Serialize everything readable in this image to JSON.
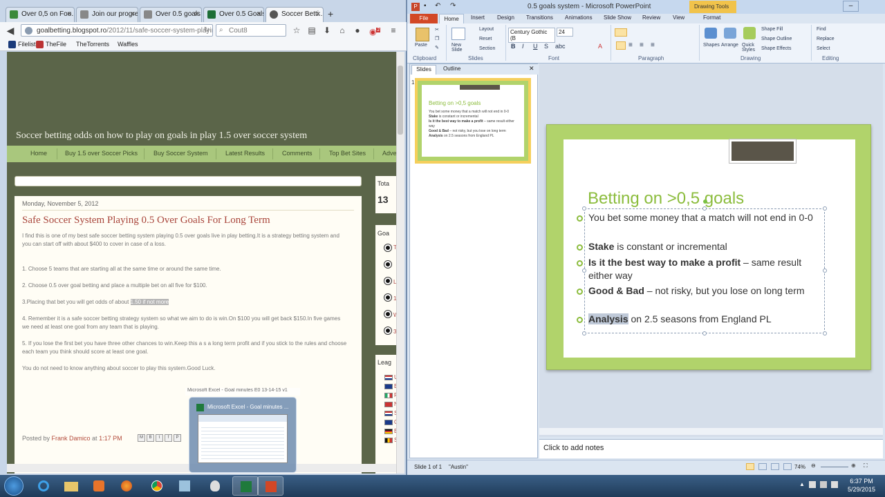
{
  "firefox": {
    "tabs": [
      {
        "label": "Over 0,5 on Foo...",
        "color": "#3b8a3b"
      },
      {
        "label": "Join our progres...",
        "color": "#888"
      },
      {
        "label": "Over 0.5 goals (...",
        "color": "#888"
      },
      {
        "label": "Over 0.5 Goals P...",
        "color": "#1d6e36"
      },
      {
        "label": "Soccer Betti...",
        "color": "#555"
      }
    ],
    "new_tab": "+",
    "url_prefix": "goalbetting.blogspot.ro",
    "url_rest": "/2012/11/safe-soccer-system-playing-05-c",
    "search_placeholder": "Cout8",
    "badge": "2",
    "bookmarks": [
      "Filelist",
      "TheFile",
      "TheTorrents",
      "Waffles"
    ],
    "blog": {
      "title": "Soccer betting odds on how to play on goals in play 1.5 over soccer system",
      "menu": [
        "Home",
        "Buy 1.5 over Soccer Picks",
        "Buy Soccer System",
        "Latest Results",
        "Comments",
        "Top Bet Sites",
        "Adve"
      ],
      "date": "Monday, November 5, 2012",
      "post_title": "Safe Soccer System Playing 0.5 Over Goals For Long Term",
      "intro": "I find this is one of my best safe soccer betting system playing 0.5 over goals live in play betting.It is a strategy betting system and you can start off with about $400 to cover in case of a loss.",
      "p1": "1. Choose 5 teams that are starting all at the same time or around the same time.",
      "p2": "2. Choose 0.5 over goal betting and place a multiple bet on all five for $100.",
      "p3_a": "3.Placing that bet you will get odds of about ",
      "p3_hl": "1.50 if not more",
      "p4": "4. Remember it is a safe soccer betting strategy system so what we aim to do is win.On $100 you will get back $150.In five games we need at least one goal from any team that is playing.",
      "p5": "5. If you lose the first bet you have three other chances to win.Keep this a s a long term profit and if you stick to the rules and choose each team you think should score at least one goal.",
      "p6": "You do not need to know anything about soccer to play this system.Good Luck.",
      "posted_by": "Posted by ",
      "author": "Frank Damico",
      "at": " at ",
      "time": "1:17 PM",
      "share": [
        "M",
        "B",
        "t",
        "f",
        "P"
      ],
      "sidebar_total": "Tota",
      "sidebar_total_num": "13",
      "sidebar_goals": "Goa",
      "sidebar_leagues": "Leag",
      "sidebar_ball_letters": [
        "T",
        "",
        "L",
        "1",
        "W",
        "3"
      ],
      "sidebar_flag_letters": [
        "U",
        "E",
        "F",
        "N",
        "S",
        "G",
        "E",
        "S"
      ]
    },
    "excel_preview": {
      "tooltip": "Microsoft Excel - Goal minutes E0 13-14-15 v1",
      "title": "Microsoft Excel - Goal minutes ..."
    }
  },
  "powerpoint": {
    "title": "0.5 goals system - Microsoft PowerPoint",
    "contextual": "Drawing Tools",
    "tabs": [
      "File",
      "Home",
      "Insert",
      "Design",
      "Transitions",
      "Animations",
      "Slide Show",
      "Review",
      "View",
      "Format"
    ],
    "ribbon": {
      "paste": "Paste",
      "new_slide": "New Slide",
      "layout": "Layout",
      "reset": "Reset",
      "section": "Section",
      "font_name": "Century Gothic (B",
      "font_size": "24",
      "shapes": "Shapes",
      "arrange": "Arrange",
      "quick_styles": "Quick Styles",
      "shape_fill": "Shape Fill",
      "shape_outline": "Shape Outline",
      "shape_effects": "Shape Effects",
      "find": "Find",
      "replace": "Replace",
      "select": "Select",
      "groups": [
        "Clipboard",
        "Slides",
        "Font",
        "Paragraph",
        "Drawing",
        "Editing"
      ]
    },
    "left_tabs": [
      "Slides",
      "Outline"
    ],
    "slide_number": "1",
    "slide": {
      "title": "Betting on >0,5 goals",
      "bullets": [
        {
          "bold": "",
          "text": "You bet some money that a match will not end in 0-0"
        },
        {
          "bold": "Stake",
          "text": " is constant or incremental"
        },
        {
          "bold": "Is it the best way to make a profit",
          "text": " – same result either way"
        },
        {
          "bold": "Good & Bad",
          "text": " – not risky, but you lose on long term"
        },
        {
          "bold": "Analysis",
          "text": " on 2.5 seasons from England PL"
        }
      ]
    },
    "notes_placeholder": "Click to add notes",
    "status": {
      "slide": "Slide 1 of 1",
      "theme": "\"Austin\"",
      "zoom": "74%"
    }
  },
  "taskbar": {
    "time": "6:37 PM",
    "date": "5/29/2015"
  }
}
